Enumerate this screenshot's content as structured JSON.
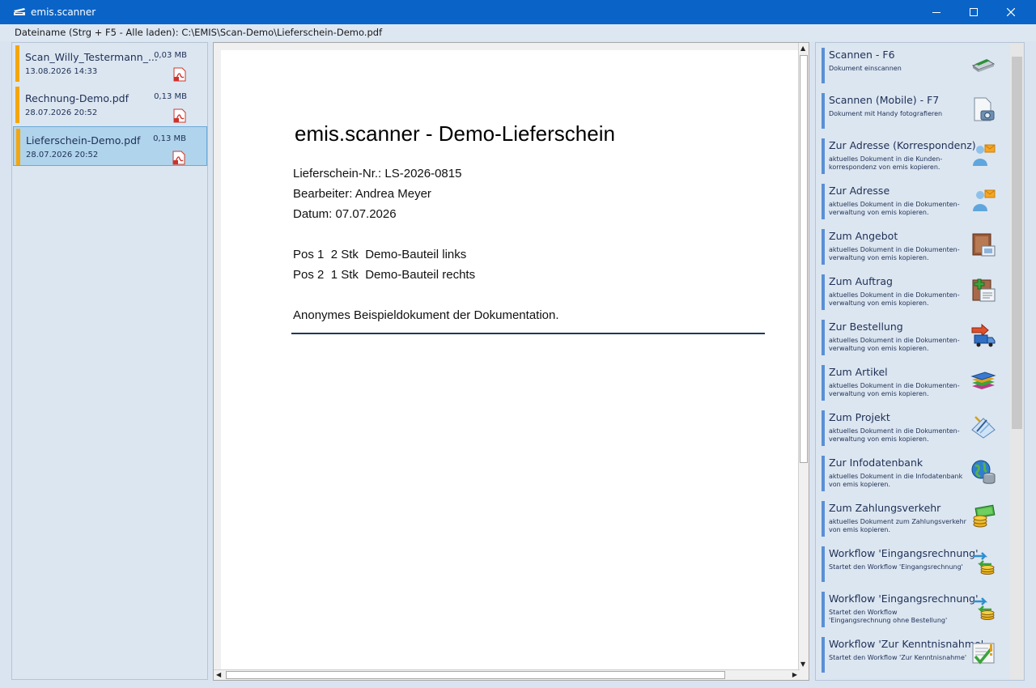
{
  "window": {
    "title": "emis.scanner",
    "icon": "scanner-app-icon"
  },
  "filebar": {
    "text": "Dateiname (Strg + F5 - Alle laden): C:\\EMIS\\Scan-Demo\\Lieferschein-Demo.pdf"
  },
  "files": [
    {
      "name": "Scan_Willy_Testermann_...",
      "size": "0,03 MB",
      "date": "13.08.2026 14:33",
      "selected": false
    },
    {
      "name": "Rechnung-Demo.pdf",
      "size": "0,13 MB",
      "date": "28.07.2026 20:52",
      "selected": false
    },
    {
      "name": "Lieferschein-Demo.pdf",
      "size": "0,13 MB",
      "date": "28.07.2026 20:52",
      "selected": true
    }
  ],
  "document": {
    "title": "emis.scanner - Demo-Lieferschein",
    "lines": [
      "Lieferschein-Nr.: LS-2026-0815",
      "Bearbeiter: Andrea Meyer",
      "Datum: 07.07.2026",
      "Pos 1  2 Stk  Demo-Bauteil links",
      "Pos 2  1 Stk  Demo-Bauteil rechts",
      "Anonymes Beispieldokument der Dokumentation."
    ]
  },
  "actions": [
    {
      "label": "Scannen - F6",
      "desc": "Dokument einscannen",
      "icon": "scanner-icon"
    },
    {
      "label": "Scannen (Mobile) - F7",
      "desc": "Dokument mit Handy fotografieren",
      "icon": "mobile-photo-icon"
    },
    {
      "label": "Zur Adresse (Korrespondenz)",
      "desc": "aktuelles Dokument in die Kunden-\nkorrespondenz von emis kopieren.",
      "icon": "contact-correspondence-icon"
    },
    {
      "label": "Zur Adresse",
      "desc": "aktuelles Dokument in die Dokumenten-\nverwaltung von emis kopieren.",
      "icon": "contact-icon"
    },
    {
      "label": "Zum Angebot",
      "desc": "aktuelles Dokument in die Dokumenten-\nverwaltung von emis kopieren.",
      "icon": "offer-icon"
    },
    {
      "label": "Zum Auftrag",
      "desc": "aktuelles Dokument in die Dokumenten-\nverwaltung von emis kopieren.",
      "icon": "order-icon"
    },
    {
      "label": "Zur Bestellung",
      "desc": "aktuelles Dokument in die Dokumenten-\nverwaltung von emis kopieren.",
      "icon": "delivery-truck-icon"
    },
    {
      "label": "Zum Artikel",
      "desc": "aktuelles Dokument in die Dokumenten-\nverwaltung von emis kopieren.",
      "icon": "article-stack-icon"
    },
    {
      "label": "Zum Projekt",
      "desc": "aktuelles Dokument in die Dokumenten-\nverwaltung von emis kopieren.",
      "icon": "project-icon"
    },
    {
      "label": "Zur Infodatenbank",
      "desc": "aktuelles Dokument in die Infodatenbank\nvon emis kopieren.",
      "icon": "globe-database-icon"
    },
    {
      "label": "Zum Zahlungsverkehr",
      "desc": "aktuelles Dokument zum Zahlungsverkehr\nvon emis kopieren.",
      "icon": "money-icon"
    },
    {
      "label": "Workflow 'Eingangsrechnung'",
      "desc": "Startet den Workflow 'Eingangsrechnung'",
      "icon": "workflow-coins-icon"
    },
    {
      "label": "Workflow 'Eingangsrechnung'",
      "desc": "Startet den Workflow\n'Eingangsrechnung ohne Bestellung'",
      "icon": "workflow-coins-icon"
    },
    {
      "label": "Workflow 'Zur Kenntnisnahme'",
      "desc": "Startet den Workflow 'Zur Kenntnisnahme'",
      "icon": "acknowledge-check-icon"
    }
  ],
  "colors": {
    "titlebar": "#0a64c8",
    "file_marker": "#f3a60d",
    "action_marker": "#5b8fd6",
    "selection": "#b0d4ec"
  }
}
